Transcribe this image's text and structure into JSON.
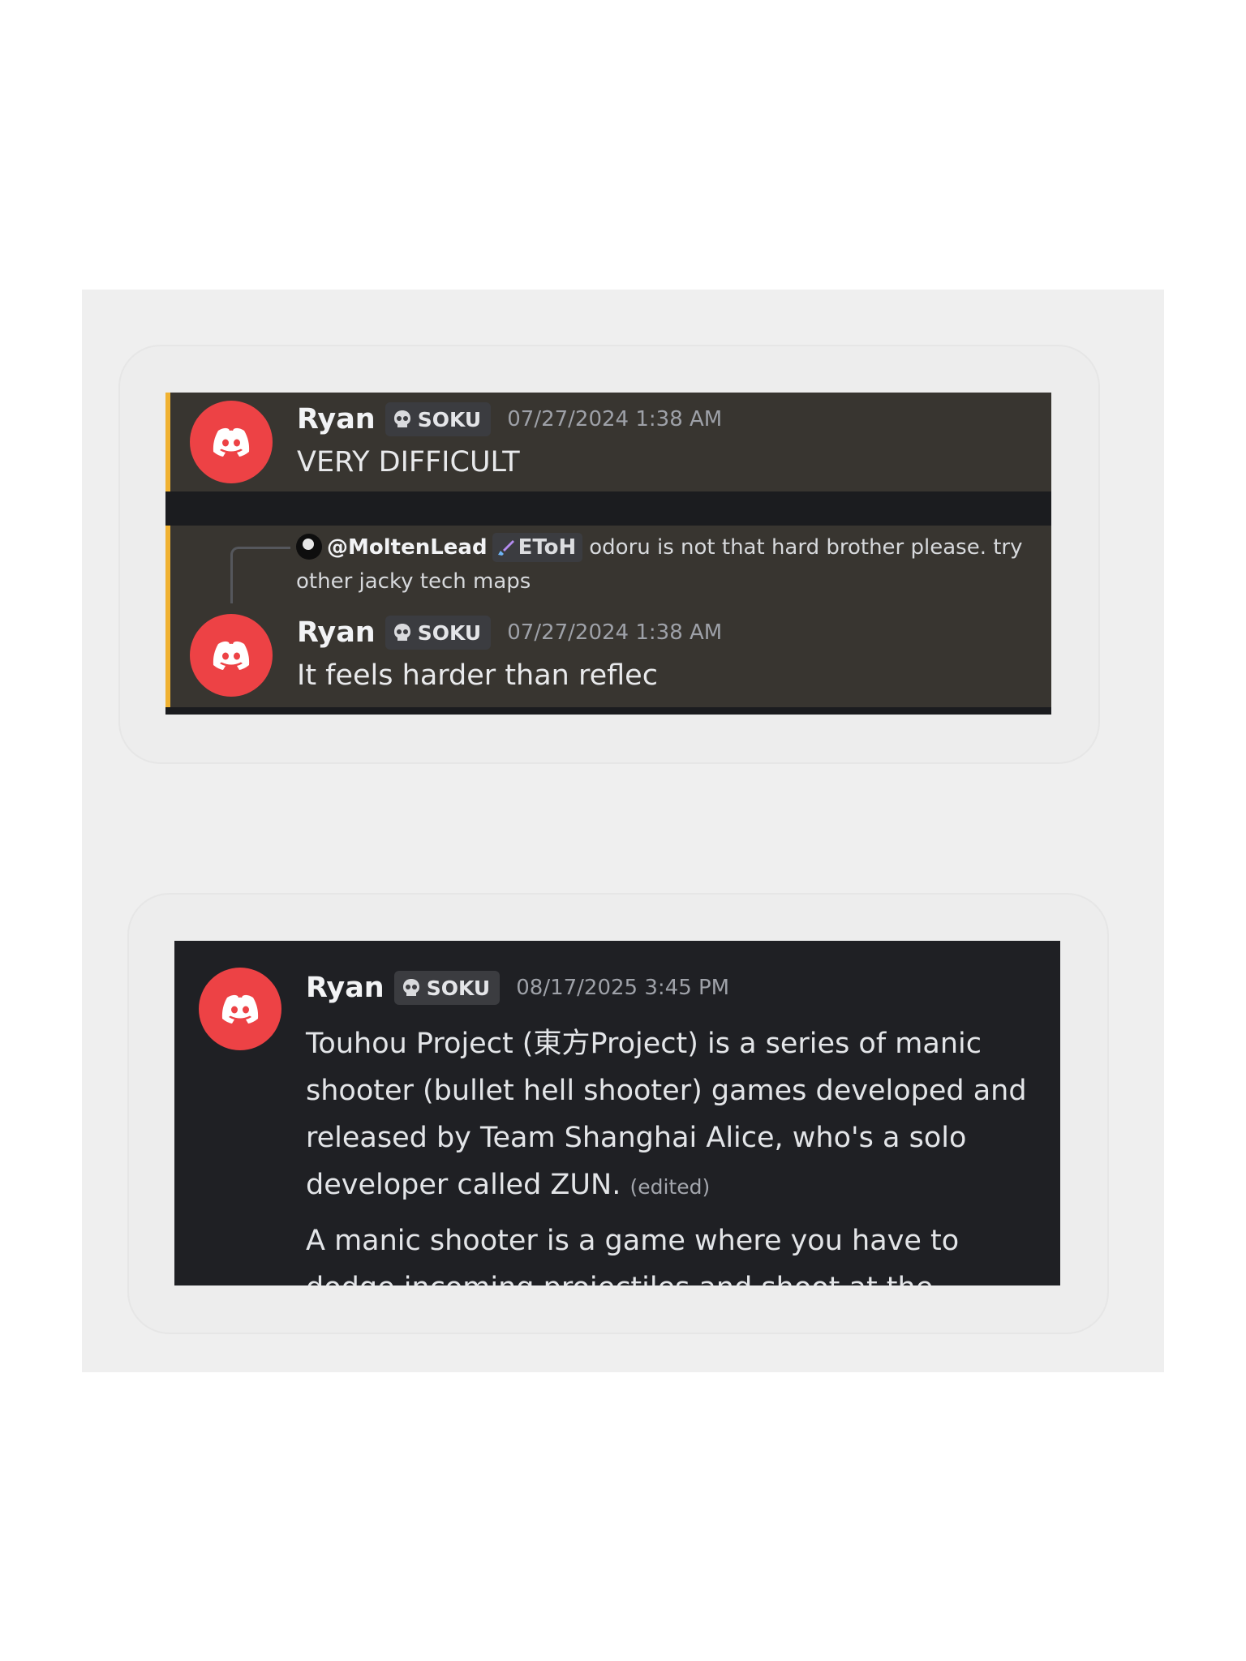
{
  "colors": {
    "highlight_bar": "#f0b232",
    "avatar": "#ed4245",
    "panel_dark": "#1f2024",
    "highlight_bg": "#383530"
  },
  "icons": {
    "avatar": "discord-logo-icon",
    "role": "skull-icon",
    "reply_role": "sword-icon"
  },
  "messages": [
    {
      "author": "Ryan",
      "tag": "SOKU",
      "timestamp": "07/27/2024 1:38 AM",
      "text": "VERY DIFFICULT"
    },
    {
      "reply": {
        "user": "@MoltenLead",
        "tag": "EToH",
        "text": "odoru is not that hard brother please. try other jacky tech maps"
      },
      "author": "Ryan",
      "tag": "SOKU",
      "timestamp": "07/27/2024 1:38 AM",
      "text": "It feels harder than reflec"
    },
    {
      "author": "Ryan",
      "tag": "SOKU",
      "timestamp": "08/17/2025 3:45 PM",
      "text": "Touhou Project (東方Project) is a series of manic shooter (bullet hell shooter) games developed and released by Team Shanghai Alice, who's a solo developer called ZUN.",
      "edited_label": "(edited)",
      "text2": "A manic shooter is a game where you have to dodge incoming projectiles and shoot at the enemies on"
    }
  ]
}
